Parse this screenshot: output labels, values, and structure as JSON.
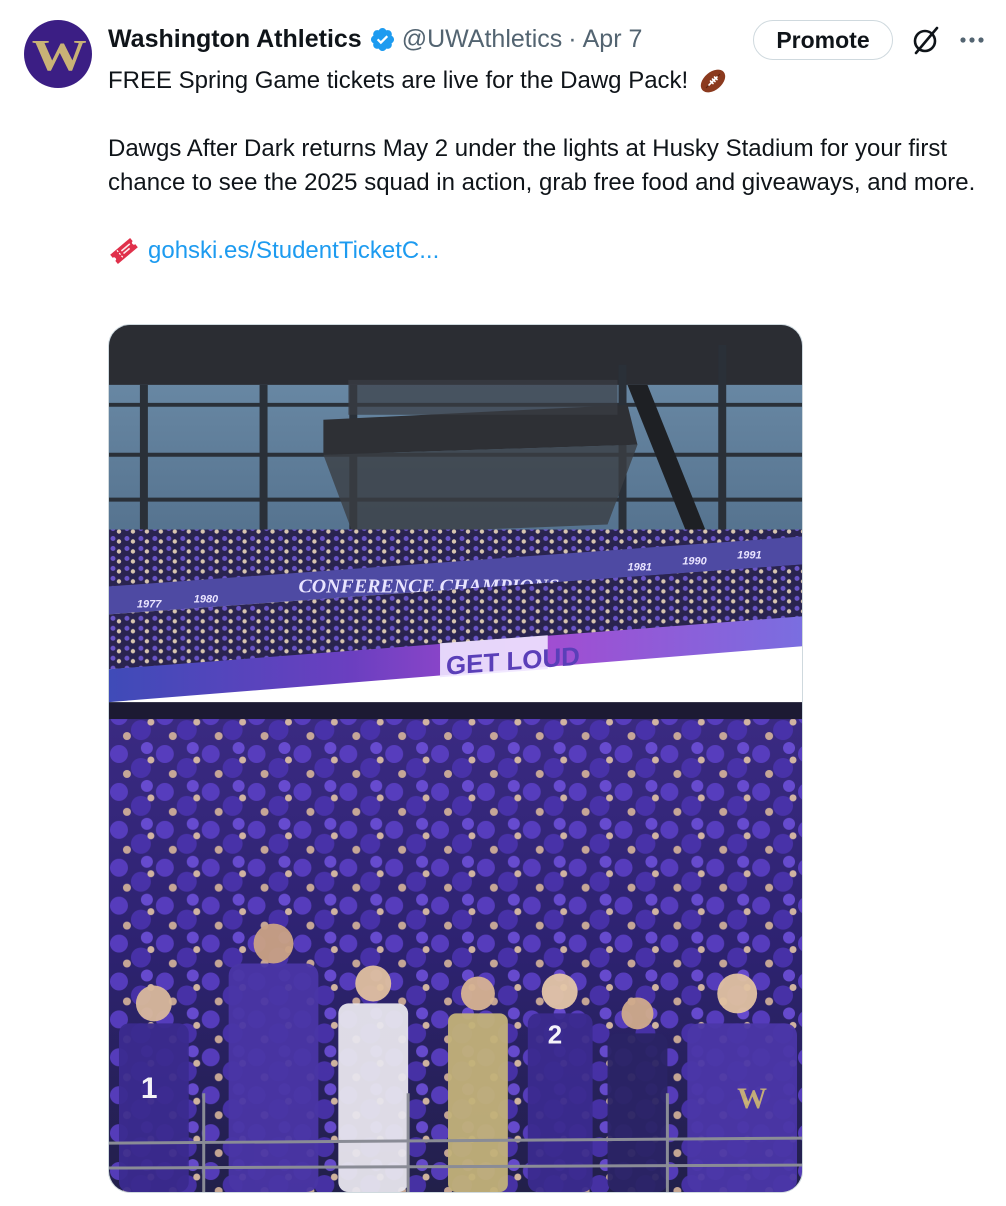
{
  "tweet": {
    "author": {
      "display_name": "Washington Athletics",
      "handle": "@UWAthletics",
      "verified": true,
      "avatar_letter": "W"
    },
    "separator": "·",
    "timestamp": "Apr 7",
    "actions": {
      "promote_label": "Promote",
      "grok_icon": "grok-icon",
      "more_icon": "more-icon"
    },
    "text": {
      "line1": "FREE Spring Game tickets are live for the Dawg Pack!",
      "line1_emoji": "football-icon",
      "paragraph2": "Dawgs After Dark returns May 2 under the lights at Husky Stadium for your first chance to see the 2025 squad in action, grab free food and giveaways, and more.",
      "link_emoji": "ticket-icon",
      "link_text": "gohski.es/StudentTicketC..."
    },
    "media": {
      "stadium_banner": "CONFERENCE CHAMPIONS",
      "banner_years": [
        "1977",
        "1980",
        "1981",
        "1990",
        "1991"
      ],
      "led_board_text": "GET LOUD"
    }
  },
  "colors": {
    "uw_purple": "#4b2e83",
    "uw_gold": "#b7a57a",
    "link_blue": "#1d9bf0",
    "verified_blue": "#1d9bf0",
    "secondary_text": "#536471"
  }
}
